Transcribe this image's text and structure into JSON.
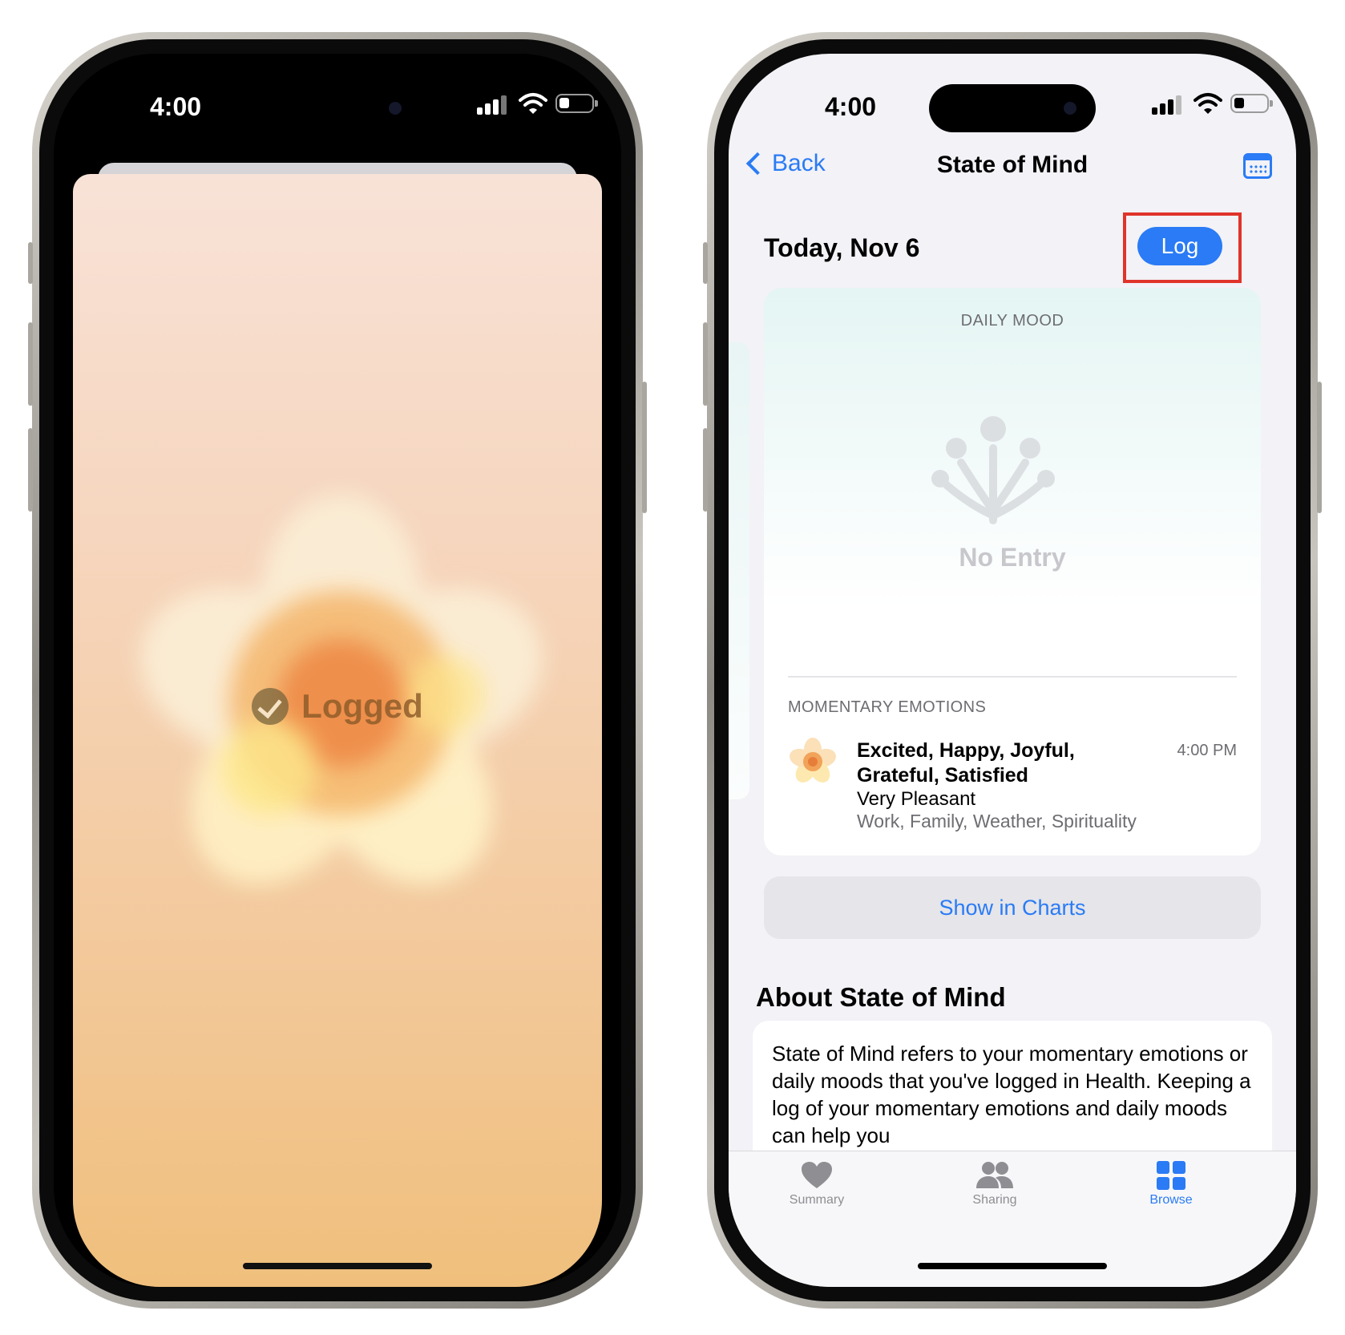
{
  "left_phone": {
    "status": {
      "time": "4:00"
    },
    "confirmation_label": "Logged"
  },
  "right_phone": {
    "status": {
      "time": "4:00"
    },
    "nav": {
      "back_label": "Back",
      "title": "State of Mind"
    },
    "date_label": "Today, Nov 6",
    "log_button_label": "Log",
    "daily_mood": {
      "label": "DAILY MOOD",
      "empty_text": "No Entry"
    },
    "momentary": {
      "label": "MOMENTARY EMOTIONS",
      "entry": {
        "emotions": "Excited, Happy, Joyful, Grateful, Satisfied",
        "time": "4:00 PM",
        "valence": "Very Pleasant",
        "associations": "Work, Family, Weather, Spirituality"
      }
    },
    "show_charts_label": "Show in Charts",
    "about": {
      "title": "About State of Mind",
      "body": "State of Mind refers to your momentary emotions or daily moods that you've logged in Health. Keeping a log of your momentary emotions and daily moods can help you"
    },
    "tabs": [
      {
        "label": "Summary",
        "icon": "heart-icon",
        "active": false
      },
      {
        "label": "Sharing",
        "icon": "people-icon",
        "active": false
      },
      {
        "label": "Browse",
        "icon": "grid-icon",
        "active": true
      }
    ]
  },
  "colors": {
    "accent": "#2a7bf5",
    "highlight": "#e0342a",
    "tab_inactive": "#8e8e93"
  }
}
